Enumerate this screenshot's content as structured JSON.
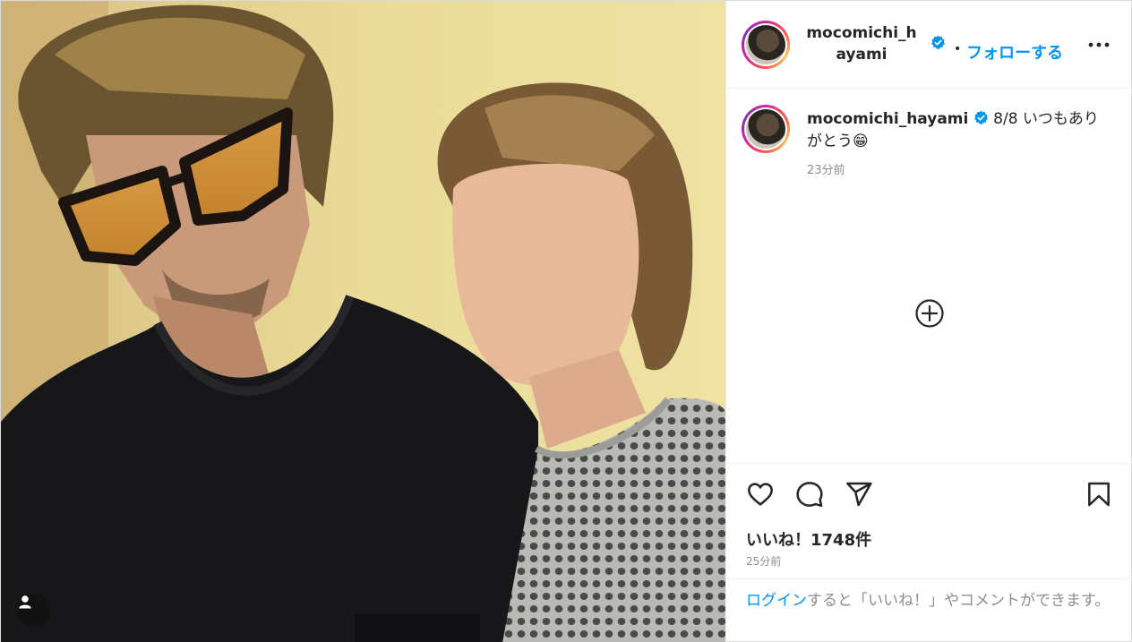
{
  "header": {
    "username": "mocomichi_hayami",
    "separator": "•",
    "follow_label": "フォローする"
  },
  "caption": {
    "username": "mocomichi_hayami",
    "text": "8/8 いつもありがとう",
    "emoji": "😁",
    "time": "23分前"
  },
  "engagement": {
    "likes": "いいね！1748件",
    "time": "25分前"
  },
  "login_prompt": {
    "link_text": "ログイン",
    "rest_text": "すると「いいね！」やコメントができます。"
  },
  "icons": {
    "verified": "verified-badge-icon",
    "more": "more-options-icon",
    "load_more": "plus-circle-icon",
    "like": "heart-icon",
    "comment": "comment-icon",
    "share": "share-paper-plane-icon",
    "save": "bookmark-icon",
    "user_tag": "user-tag-icon"
  },
  "colors": {
    "link_blue": "#0095f6",
    "verified_blue": "#0095f6",
    "text": "#262626",
    "secondary_text": "#8e8e8e"
  }
}
